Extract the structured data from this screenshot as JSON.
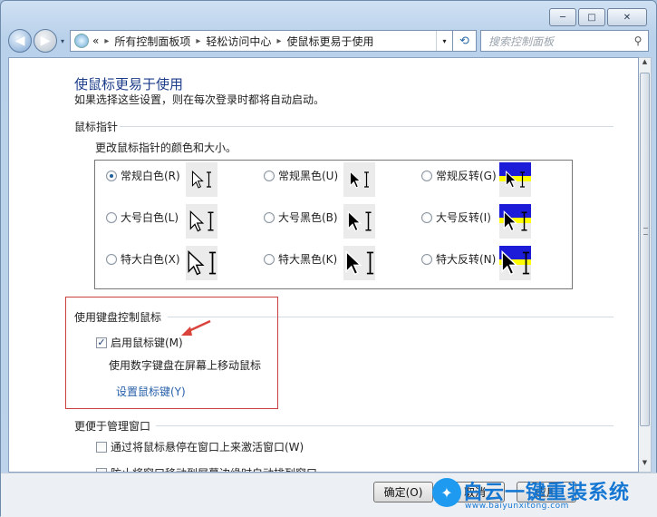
{
  "window": {
    "caption_minimize": "─",
    "caption_maximize": "□",
    "caption_close": "✕"
  },
  "nav": {
    "back_glyph": "◀",
    "fwd_glyph": "▶",
    "drop_glyph": "▾",
    "breadcrumb_lead": "«",
    "breadcrumb": [
      "所有控制面板项",
      "轻松访问中心",
      "使鼠标更易于使用"
    ],
    "separator": "▸",
    "refresh_glyph": "⟲",
    "search_placeholder": "搜索控制面板",
    "search_glyph": "⚲"
  },
  "page": {
    "title": "使鼠标更易于使用",
    "subtitle": "如果选择这些设置，则在每次登录时都将自动启动。"
  },
  "pointers": {
    "section_title": "鼠标指针",
    "description": "更改鼠标指针的颜色和大小。",
    "options": [
      {
        "label": "常规白色(R)",
        "selected": true,
        "style": "white-small"
      },
      {
        "label": "常规黑色(U)",
        "selected": false,
        "style": "black-small"
      },
      {
        "label": "常规反转(G)",
        "selected": false,
        "style": "invert-small"
      },
      {
        "label": "大号白色(L)",
        "selected": false,
        "style": "white-large"
      },
      {
        "label": "大号黑色(B)",
        "selected": false,
        "style": "black-large"
      },
      {
        "label": "大号反转(I)",
        "selected": false,
        "style": "invert-large"
      },
      {
        "label": "特大白色(X)",
        "selected": false,
        "style": "white-xl"
      },
      {
        "label": "特大黑色(K)",
        "selected": false,
        "style": "black-xl"
      },
      {
        "label": "特大反转(N)",
        "selected": false,
        "style": "invert-xl"
      }
    ]
  },
  "keyboard": {
    "section_title": "使用键盘控制鼠标",
    "enable_label": "启用鼠标键(M)",
    "enable_checked": true,
    "description": "使用数字键盘在屏幕上移动鼠标",
    "setup_link": "设置鼠标键(Y)"
  },
  "windows": {
    "section_title": "更便于管理窗口",
    "hover_activate_label": "通过将鼠标悬停在窗口上来激活窗口(W)",
    "hover_activate_checked": false,
    "snap_label": "防止将窗口移动到屏幕边缘时自动排列窗口",
    "snap_checked": false
  },
  "buttons": {
    "ok": "确定(O)",
    "cancel": "取消",
    "apply": "应用"
  },
  "watermark": {
    "brand": "白云一键重装系统",
    "url": "www.baiyunxitong.com"
  },
  "colors": {
    "title_blue": "#1d3d8a",
    "link_blue": "#2760a9",
    "highlight_red": "#c8403b",
    "annotation_arrow": "#d9433b"
  }
}
